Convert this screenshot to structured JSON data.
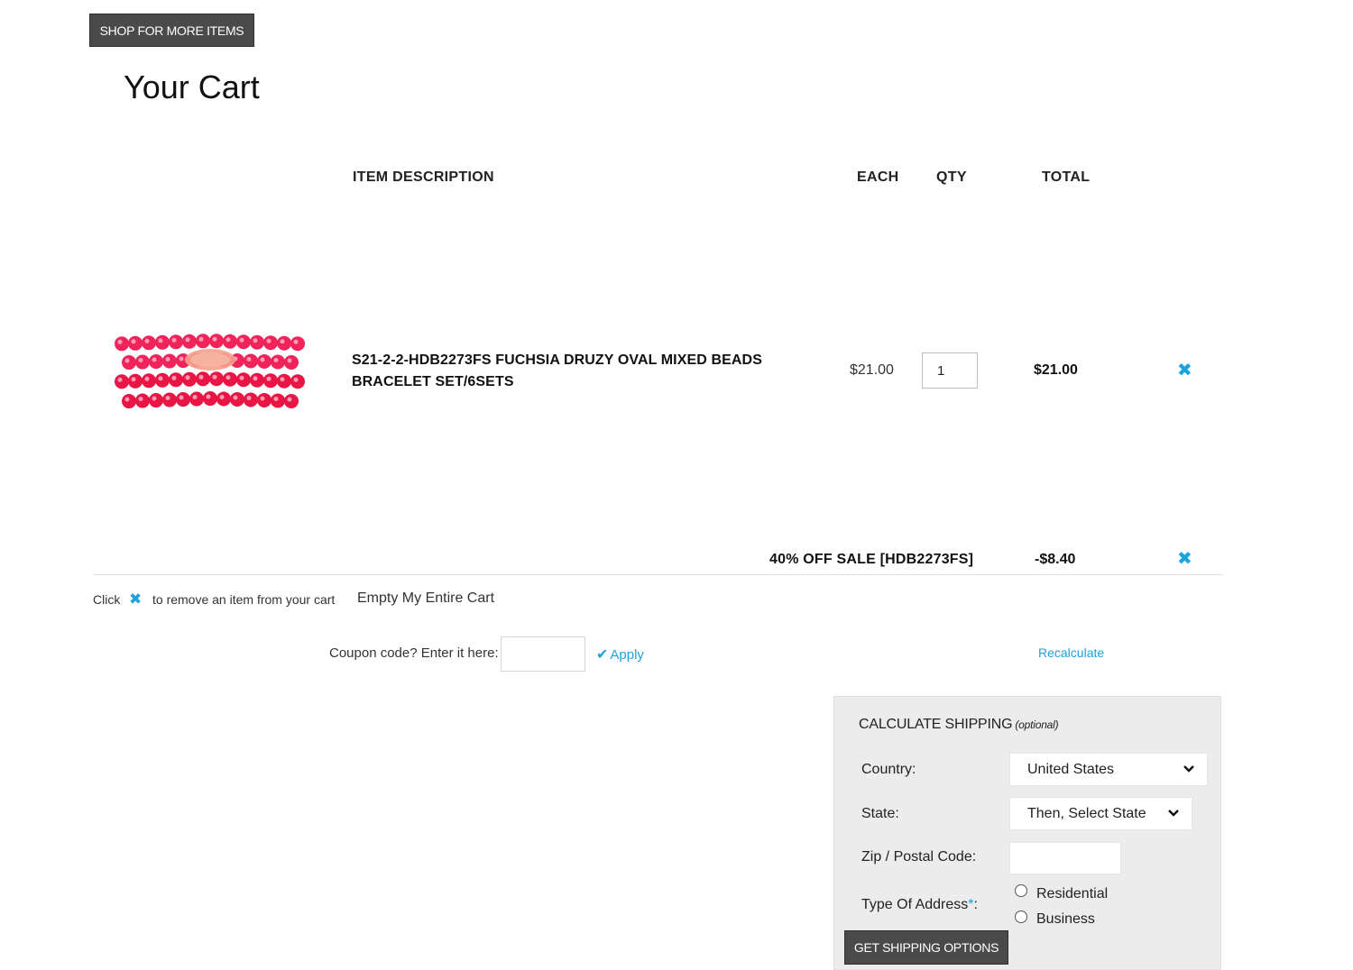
{
  "header": {
    "shop_button_label": "SHOP FOR MORE ITEMS",
    "page_title": "Your Cart"
  },
  "table_headers": {
    "item_description": "ITEM  DESCRIPTION",
    "each": "EACH",
    "qty": "QTY",
    "total": "TOTAL"
  },
  "cart_items": [
    {
      "description_line1": "S21-2-2-HDB2273FS FUCHSIA DRUZY OVAL MIXED BEADS",
      "description_line2": "BRACELET SET/6SETS",
      "each": "$21.00",
      "qty": "1",
      "total": "$21.00",
      "image_icon": "bracelet-product-image",
      "remove_icon": "close-icon"
    }
  ],
  "discount": {
    "label": "40% OFF SALE [HDB2273FS]",
    "amount": "-$8.40"
  },
  "hint": {
    "before": "Click",
    "after": "to remove an item from your cart",
    "empty_cart": "Empty My Entire Cart"
  },
  "coupon": {
    "label": "Coupon code? Enter it here:",
    "value": "",
    "apply_label": "Apply",
    "recalculate_label": "Recalculate"
  },
  "shipping": {
    "title": "CALCULATE SHIPPING",
    "optional": "(optional)",
    "country_label": "Country:",
    "country_value": "United States",
    "state_label": "State:",
    "state_value": "Then, Select State",
    "zip_label": "Zip / Postal Code:",
    "zip_value": "",
    "address_type_label": "Type Of Address",
    "address_type_required": "*",
    "address_type_colon": ":",
    "options": [
      "Residential",
      "Business"
    ],
    "button_label": "GET SHIPPING OPTIONS"
  },
  "colors": {
    "accent": "#1aa3dc",
    "dark_button": "#4a4a4a",
    "panel_bg": "#ececec",
    "product_pink": "#f0245a"
  }
}
